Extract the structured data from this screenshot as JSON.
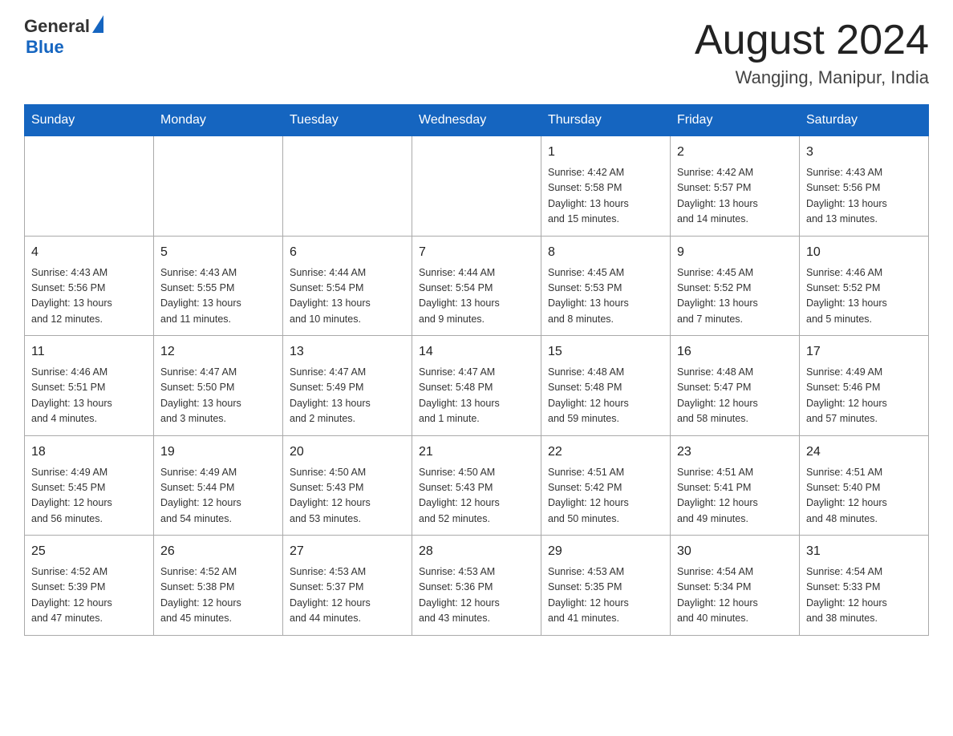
{
  "header": {
    "logo": {
      "text_general": "General",
      "text_blue": "Blue",
      "triangle_icon": "triangle-icon"
    },
    "month_year": "August 2024",
    "location": "Wangjing, Manipur, India"
  },
  "calendar": {
    "day_headers": [
      "Sunday",
      "Monday",
      "Tuesday",
      "Wednesday",
      "Thursday",
      "Friday",
      "Saturday"
    ],
    "weeks": [
      [
        {
          "day": "",
          "info": ""
        },
        {
          "day": "",
          "info": ""
        },
        {
          "day": "",
          "info": ""
        },
        {
          "day": "",
          "info": ""
        },
        {
          "day": "1",
          "info": "Sunrise: 4:42 AM\nSunset: 5:58 PM\nDaylight: 13 hours\nand 15 minutes."
        },
        {
          "day": "2",
          "info": "Sunrise: 4:42 AM\nSunset: 5:57 PM\nDaylight: 13 hours\nand 14 minutes."
        },
        {
          "day": "3",
          "info": "Sunrise: 4:43 AM\nSunset: 5:56 PM\nDaylight: 13 hours\nand 13 minutes."
        }
      ],
      [
        {
          "day": "4",
          "info": "Sunrise: 4:43 AM\nSunset: 5:56 PM\nDaylight: 13 hours\nand 12 minutes."
        },
        {
          "day": "5",
          "info": "Sunrise: 4:43 AM\nSunset: 5:55 PM\nDaylight: 13 hours\nand 11 minutes."
        },
        {
          "day": "6",
          "info": "Sunrise: 4:44 AM\nSunset: 5:54 PM\nDaylight: 13 hours\nand 10 minutes."
        },
        {
          "day": "7",
          "info": "Sunrise: 4:44 AM\nSunset: 5:54 PM\nDaylight: 13 hours\nand 9 minutes."
        },
        {
          "day": "8",
          "info": "Sunrise: 4:45 AM\nSunset: 5:53 PM\nDaylight: 13 hours\nand 8 minutes."
        },
        {
          "day": "9",
          "info": "Sunrise: 4:45 AM\nSunset: 5:52 PM\nDaylight: 13 hours\nand 7 minutes."
        },
        {
          "day": "10",
          "info": "Sunrise: 4:46 AM\nSunset: 5:52 PM\nDaylight: 13 hours\nand 5 minutes."
        }
      ],
      [
        {
          "day": "11",
          "info": "Sunrise: 4:46 AM\nSunset: 5:51 PM\nDaylight: 13 hours\nand 4 minutes."
        },
        {
          "day": "12",
          "info": "Sunrise: 4:47 AM\nSunset: 5:50 PM\nDaylight: 13 hours\nand 3 minutes."
        },
        {
          "day": "13",
          "info": "Sunrise: 4:47 AM\nSunset: 5:49 PM\nDaylight: 13 hours\nand 2 minutes."
        },
        {
          "day": "14",
          "info": "Sunrise: 4:47 AM\nSunset: 5:48 PM\nDaylight: 13 hours\nand 1 minute."
        },
        {
          "day": "15",
          "info": "Sunrise: 4:48 AM\nSunset: 5:48 PM\nDaylight: 12 hours\nand 59 minutes."
        },
        {
          "day": "16",
          "info": "Sunrise: 4:48 AM\nSunset: 5:47 PM\nDaylight: 12 hours\nand 58 minutes."
        },
        {
          "day": "17",
          "info": "Sunrise: 4:49 AM\nSunset: 5:46 PM\nDaylight: 12 hours\nand 57 minutes."
        }
      ],
      [
        {
          "day": "18",
          "info": "Sunrise: 4:49 AM\nSunset: 5:45 PM\nDaylight: 12 hours\nand 56 minutes."
        },
        {
          "day": "19",
          "info": "Sunrise: 4:49 AM\nSunset: 5:44 PM\nDaylight: 12 hours\nand 54 minutes."
        },
        {
          "day": "20",
          "info": "Sunrise: 4:50 AM\nSunset: 5:43 PM\nDaylight: 12 hours\nand 53 minutes."
        },
        {
          "day": "21",
          "info": "Sunrise: 4:50 AM\nSunset: 5:43 PM\nDaylight: 12 hours\nand 52 minutes."
        },
        {
          "day": "22",
          "info": "Sunrise: 4:51 AM\nSunset: 5:42 PM\nDaylight: 12 hours\nand 50 minutes."
        },
        {
          "day": "23",
          "info": "Sunrise: 4:51 AM\nSunset: 5:41 PM\nDaylight: 12 hours\nand 49 minutes."
        },
        {
          "day": "24",
          "info": "Sunrise: 4:51 AM\nSunset: 5:40 PM\nDaylight: 12 hours\nand 48 minutes."
        }
      ],
      [
        {
          "day": "25",
          "info": "Sunrise: 4:52 AM\nSunset: 5:39 PM\nDaylight: 12 hours\nand 47 minutes."
        },
        {
          "day": "26",
          "info": "Sunrise: 4:52 AM\nSunset: 5:38 PM\nDaylight: 12 hours\nand 45 minutes."
        },
        {
          "day": "27",
          "info": "Sunrise: 4:53 AM\nSunset: 5:37 PM\nDaylight: 12 hours\nand 44 minutes."
        },
        {
          "day": "28",
          "info": "Sunrise: 4:53 AM\nSunset: 5:36 PM\nDaylight: 12 hours\nand 43 minutes."
        },
        {
          "day": "29",
          "info": "Sunrise: 4:53 AM\nSunset: 5:35 PM\nDaylight: 12 hours\nand 41 minutes."
        },
        {
          "day": "30",
          "info": "Sunrise: 4:54 AM\nSunset: 5:34 PM\nDaylight: 12 hours\nand 40 minutes."
        },
        {
          "day": "31",
          "info": "Sunrise: 4:54 AM\nSunset: 5:33 PM\nDaylight: 12 hours\nand 38 minutes."
        }
      ]
    ]
  }
}
